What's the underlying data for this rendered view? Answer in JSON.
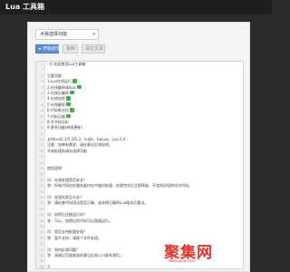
{
  "app": {
    "title": "Lua 工具箱"
  },
  "toolbar": {
    "select_value": "点我选择功能",
    "run_label": "开始处理",
    "copy_label": "复制",
    "clear_label": "清空文本"
  },
  "editor": {
    "lines": [
      {
        "text": "--[[ 欢迎使用Lua工具箱",
        "badge": false
      },
      {
        "text": "",
        "badge": false
      },
      {
        "text": "主要功能：",
        "badge": false
      },
      {
        "text": "1.Lua在线运行",
        "badge": true
      },
      {
        "text": "2.在线编译成luac",
        "badge": true
      },
      {
        "text": "3.在线反编译",
        "badge": true
      },
      {
        "text": "4.在线加密",
        "badge": true
      },
      {
        "text": "5.在线解密",
        "badge": true
      },
      {
        "text": "6.代码格式化",
        "badge": true
      },
      {
        "text": "7.代码压缩",
        "badge": true
      },
      {
        "text": "8.字节码分析",
        "badge": false
      },
      {
        "text": "9.更多功能(持续更新)",
        "badge": false
      },
      {
        "text": "",
        "badge": false
      },
      {
        "text": "支持Lua5.1/5.2/5.3、luajit、GoLua、Lua 5.4",
        "badge": false
      },
      {
        "text": "注意：如果有需求，请在意见反馈说明。",
        "badge": false
      },
      {
        "text": "开始处理前请先选择功能",
        "badge": false
      },
      {
        "text": "",
        "badge": false
      },
      {
        "text": "",
        "badge": false
      },
      {
        "text": "使用说明：",
        "badge": false
      },
      {
        "text": "",
        "badge": false
      },
      {
        "text": "问：在线处理是否安全？",
        "badge": false
      },
      {
        "text": "答：所有代码仅在服务器内存中临时处理，处理完毕后立即释放，不会保存您的任何代码。",
        "badge": false
      },
      {
        "text": "",
        "badge": false
      },
      {
        "text": "问：处理失败怎么办？",
        "badge": false
      },
      {
        "text": "答：请检查代码语法是否正确，或选择正确的Lua版本后重试。",
        "badge": false
      },
      {
        "text": "",
        "badge": false
      },
      {
        "text": "问：加密后还能运行吗？",
        "badge": false
      },
      {
        "text": "答：可以，加密后的代码可以直接运行。",
        "badge": false
      },
      {
        "text": "",
        "badge": false
      },
      {
        "text": "问：是否支持批量处理？",
        "badge": false
      },
      {
        "text": "答：暂不支持，请逐个文件处理。",
        "badge": false
      },
      {
        "text": "",
        "badge": false
      },
      {
        "text": "问：如何反馈问题？",
        "badge": false
      },
      {
        "text": "答：请通过页面底部的意见反馈入口联系我们。",
        "badge": false
      },
      {
        "text": "",
        "badge": false
      },
      {
        "text": "]]",
        "badge": false
      }
    ]
  },
  "watermark": {
    "text": "聚集网",
    "sub": "www.jujiw.com"
  },
  "colors": {
    "accent": "#5b8fd6",
    "badge": "#3fb13f",
    "watermark": "#e3322c"
  }
}
